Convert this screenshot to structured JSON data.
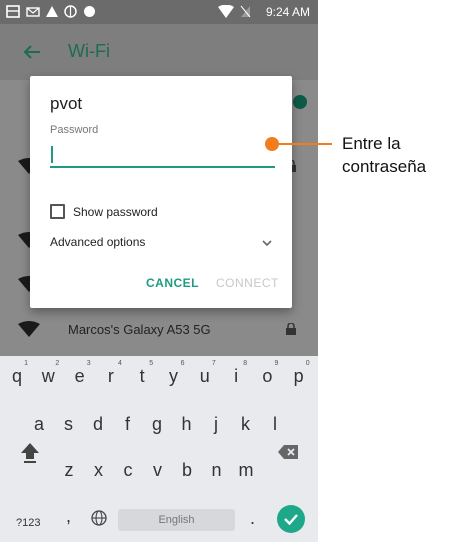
{
  "status_bar": {
    "time": "9:24 AM"
  },
  "app_bar": {
    "title": "Wi-Fi"
  },
  "networks": [
    {
      "name": "Marcos's Galaxy A53 5G",
      "locked": true
    }
  ],
  "dialog": {
    "title": "pvot",
    "password_label": "Password",
    "password_value": "",
    "show_password_label": "Show password",
    "show_password_checked": false,
    "advanced_label": "Advanced options",
    "cancel_label": "CANCEL",
    "connect_label": "CONNECT"
  },
  "keyboard": {
    "row1": [
      {
        "k": "q",
        "h": "1"
      },
      {
        "k": "w",
        "h": "2"
      },
      {
        "k": "e",
        "h": "3"
      },
      {
        "k": "r",
        "h": "4"
      },
      {
        "k": "t",
        "h": "5"
      },
      {
        "k": "y",
        "h": "6"
      },
      {
        "k": "u",
        "h": "7"
      },
      {
        "k": "i",
        "h": "8"
      },
      {
        "k": "o",
        "h": "9"
      },
      {
        "k": "p",
        "h": "0"
      }
    ],
    "row2": [
      "a",
      "s",
      "d",
      "f",
      "g",
      "h",
      "j",
      "k",
      "l"
    ],
    "row3": [
      "z",
      "x",
      "c",
      "v",
      "b",
      "n",
      "m"
    ],
    "symbols_label": "?123",
    "comma": ",",
    "space_label": "English",
    "period": "."
  },
  "callout": {
    "line1": "Entre la",
    "line2": "contraseña"
  },
  "colors": {
    "accent": "#1e9b82",
    "callout": "#f37c1c",
    "title_green": "#1c6b54"
  },
  "icons": [
    "wifi-icon",
    "lock-icon",
    "back-arrow-icon",
    "chevron-down-icon",
    "shift-icon",
    "backspace-icon",
    "globe-icon",
    "check-icon"
  ]
}
